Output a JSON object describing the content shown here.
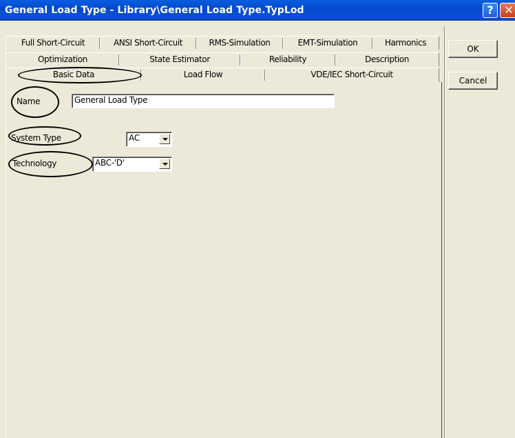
{
  "window": {
    "title": "General Load Type - Library\\General Load Type.TypLod",
    "help_glyph": "?",
    "close_glyph": "✕"
  },
  "tabs": {
    "row1": [
      "Full Short-Circuit",
      "ANSI Short-Circuit",
      "RMS-Simulation",
      "EMT-Simulation",
      "Harmonics"
    ],
    "row2": [
      "Optimization",
      "State Estimator",
      "Reliability",
      "Description"
    ],
    "row3": [
      "Basic Data",
      "Load Flow",
      "VDE/IEC Short-Circuit"
    ],
    "active": "Basic Data"
  },
  "buttons": {
    "ok": "OK",
    "cancel": "Cancel"
  },
  "form": {
    "name_label": "Name",
    "name_value": "General Load Type",
    "system_type_label": "System Type",
    "system_type_value": "AC",
    "technology_label": "Technology",
    "technology_value": "ABC-'D'"
  }
}
